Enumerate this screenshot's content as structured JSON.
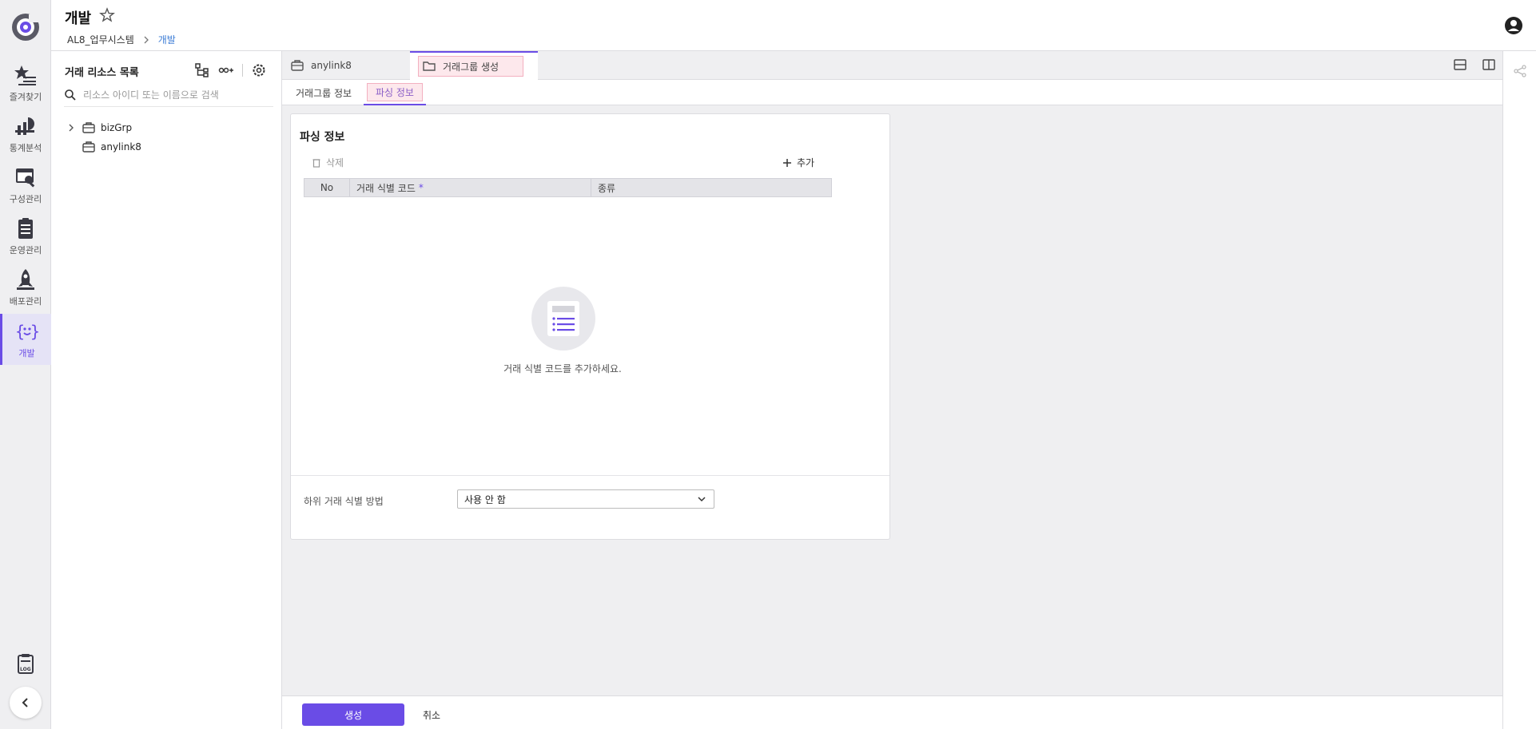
{
  "colors": {
    "accent": "#6a4ce6",
    "link": "#3a7bd5",
    "highlight_bg": "#fde8ec"
  },
  "header": {
    "title": "개발",
    "breadcrumb": [
      "AL8_업무시스템",
      "개발"
    ]
  },
  "rail": {
    "items": [
      {
        "label": "즐겨찾기",
        "icon": "favorites-icon"
      },
      {
        "label": "통계분석",
        "icon": "statistics-icon"
      },
      {
        "label": "구성관리",
        "icon": "config-icon"
      },
      {
        "label": "운영관리",
        "icon": "operations-icon"
      },
      {
        "label": "배포관리",
        "icon": "deploy-icon"
      },
      {
        "label": "개발",
        "icon": "dev-icon",
        "active": true
      }
    ]
  },
  "sidebar": {
    "title": "거래 리소스 목록",
    "search_placeholder": "리소스 아이디 또는 이름으로 검색",
    "tree": [
      {
        "label": "bizGrp",
        "expandable": true
      },
      {
        "label": "anylink8",
        "expandable": false
      }
    ]
  },
  "tabs": [
    {
      "label": "anylink8",
      "icon": "briefcase-icon"
    },
    {
      "label": "거래그룹 생성",
      "icon": "folder-icon",
      "active": true
    }
  ],
  "subtabs": [
    {
      "label": "거래그룹 정보"
    },
    {
      "label": "파싱 정보",
      "active": true
    }
  ],
  "card": {
    "title": "파싱 정보",
    "delete_label": "삭제",
    "add_label": "추가",
    "columns": {
      "no": "No",
      "code": "거래 식별 코드",
      "required_mark": "*",
      "kind": "종류"
    },
    "empty_message": "거래 식별 코드를 추가하세요.",
    "field_label": "하위 거래 식별 방법",
    "select_value": "사용 안 함"
  },
  "footer": {
    "create_label": "생성",
    "cancel_label": "취소"
  }
}
